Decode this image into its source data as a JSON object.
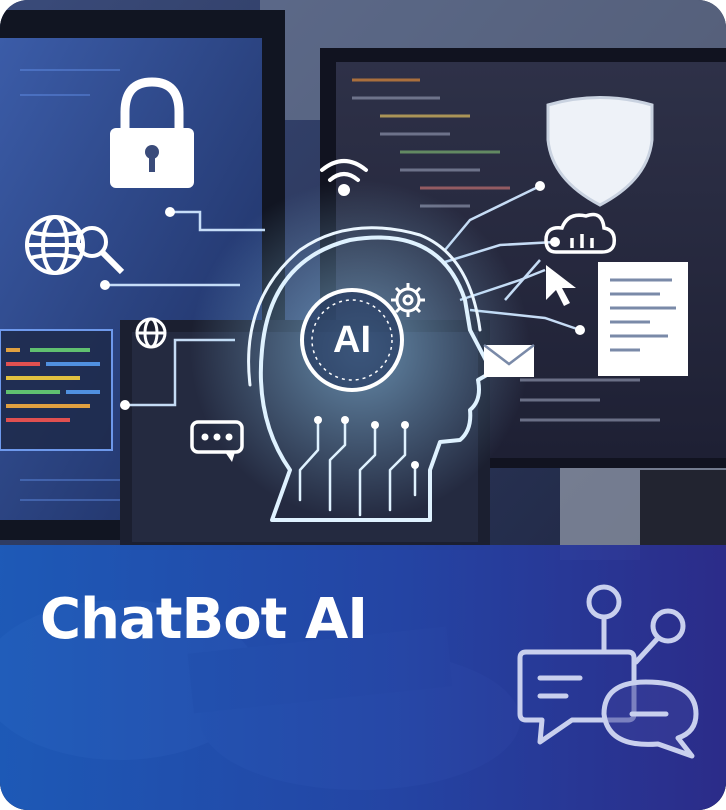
{
  "card": {
    "title": "ChatBot AI",
    "ai_label": "AI",
    "accent_color": "#2a5cc6",
    "banner_color_end": "#2c2c8c",
    "icons": [
      "lock-icon",
      "globe-search-icon",
      "wifi-icon",
      "shield-icon",
      "cloud-icon",
      "cursor-icon",
      "document-icon",
      "envelope-icon",
      "globe-icon",
      "speech-bubble-icon",
      "gear-icon",
      "head-circuit-icon",
      "chat-network-icon"
    ]
  }
}
